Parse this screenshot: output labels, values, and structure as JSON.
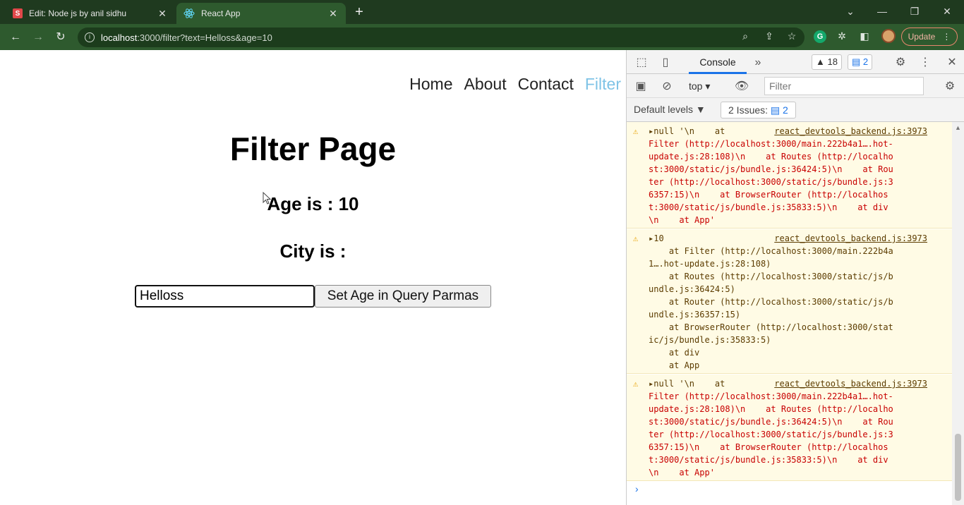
{
  "browser": {
    "tabs": [
      {
        "favicon": "S",
        "title": "Edit: Node js by anil sidhu",
        "close": "✕"
      },
      {
        "title": "React App",
        "close": "✕"
      }
    ],
    "new_tab": "+",
    "window_controls": {
      "dropdown": "⌄",
      "minimize": "—",
      "restore": "❐",
      "close": "✕"
    },
    "url_host": "localhost",
    "url_rest": ":3000/filter?text=Helloss&age=10",
    "update_label": "Update",
    "extension_letter": "G"
  },
  "page": {
    "nav": [
      "Home",
      "About",
      "Contact",
      "Filter"
    ],
    "title": "Filter Page",
    "age_line": "Age is : 10",
    "city_line": "City is :",
    "input_value": "Helloss",
    "button_label": "Set Age in Query Parmas",
    "accent_color": "#7fc3e6"
  },
  "devtools": {
    "console_tab": "Console",
    "more_tabs": "»",
    "warnings_count": "▲ 18",
    "messages_count": "2",
    "context": "top",
    "filter_placeholder": "Filter",
    "levels": "Default levels ▼",
    "issues_label": "2 Issues:",
    "issues_count": "2",
    "messages": [
      {
        "source": "react_devtools_backend.js:3973",
        "lines": [
          "▸null '\\n    at",
          "Filter (http://localhost:3000/main.222b4a1….hot-",
          "update.js:28:108)\\n    at Routes (http://localho",
          "st:3000/static/js/bundle.js:36424:5)\\n    at Rou",
          "ter (http://localhost:3000/static/js/bundle.js:3",
          "6357:15)\\n    at BrowserRouter (http://localhos",
          "t:3000/static/js/bundle.js:35833:5)\\n    at div",
          "\\n    at App'"
        ]
      },
      {
        "source": "react_devtools_backend.js:3973",
        "lines": [
          "▸10",
          "    at Filter (http://localhost:3000/main.222b4a",
          "1….hot-update.js:28:108)",
          "    at Routes (http://localhost:3000/static/js/b",
          "undle.js:36424:5)",
          "    at Router (http://localhost:3000/static/js/b",
          "undle.js:36357:15)",
          "    at BrowserRouter (http://localhost:3000/stat",
          "ic/js/bundle.js:35833:5)",
          "    at div",
          "    at App"
        ]
      },
      {
        "source": "react_devtools_backend.js:3973",
        "lines": [
          "▸null '\\n    at",
          "Filter (http://localhost:3000/main.222b4a1….hot-",
          "update.js:28:108)\\n    at Routes (http://localho",
          "st:3000/static/js/bundle.js:36424:5)\\n    at Rou",
          "ter (http://localhost:3000/static/js/bundle.js:3",
          "6357:15)\\n    at BrowserRouter (http://localhos",
          "t:3000/static/js/bundle.js:35833:5)\\n    at div",
          "\\n    at App'"
        ]
      }
    ],
    "prompt": "›"
  }
}
